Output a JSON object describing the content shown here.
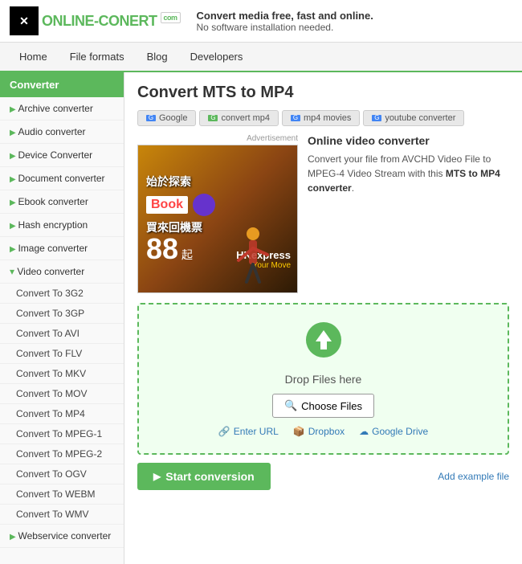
{
  "header": {
    "logo_text": "ONLINE-CON",
    "logo_text2": "ERT",
    "logo_badge": "com",
    "tagline_strong": "Convert media free, fast and online.",
    "tagline_sub": "No software installation needed."
  },
  "nav": {
    "items": [
      {
        "label": "Home"
      },
      {
        "label": "File formats"
      },
      {
        "label": "Blog"
      },
      {
        "label": "Developers"
      }
    ]
  },
  "sidebar": {
    "title": "Converter",
    "items": [
      {
        "label": "Archive converter",
        "type": "arrow"
      },
      {
        "label": "Audio converter",
        "type": "arrow"
      },
      {
        "label": "Device Converter",
        "type": "arrow"
      },
      {
        "label": "Document converter",
        "type": "arrow"
      },
      {
        "label": "Ebook converter",
        "type": "arrow"
      },
      {
        "label": "Hash encryption",
        "type": "arrow"
      },
      {
        "label": "Image converter",
        "type": "arrow"
      },
      {
        "label": "Video converter",
        "type": "open"
      },
      {
        "label": "Convert To 3G2",
        "type": "sub"
      },
      {
        "label": "Convert To 3GP",
        "type": "sub"
      },
      {
        "label": "Convert To AVI",
        "type": "sub"
      },
      {
        "label": "Convert To FLV",
        "type": "sub"
      },
      {
        "label": "Convert To MKV",
        "type": "sub"
      },
      {
        "label": "Convert To MOV",
        "type": "sub"
      },
      {
        "label": "Convert To MP4",
        "type": "sub"
      },
      {
        "label": "Convert To MPEG-1",
        "type": "sub"
      },
      {
        "label": "Convert To MPEG-2",
        "type": "sub"
      },
      {
        "label": "Convert To OGV",
        "type": "sub"
      },
      {
        "label": "Convert To WEBM",
        "type": "sub"
      },
      {
        "label": "Convert To WMV",
        "type": "sub"
      },
      {
        "label": "Webservice converter",
        "type": "arrow"
      }
    ]
  },
  "main": {
    "page_title": "Convert MTS to MP4",
    "tabs": [
      {
        "label": "Google",
        "icon": "g"
      },
      {
        "label": "convert mp4",
        "icon": "g"
      },
      {
        "label": "mp4 movies",
        "icon": "g"
      },
      {
        "label": "youtube converter",
        "icon": "g"
      }
    ],
    "ad_label": "Advertisement",
    "ad_chinese1": "始於探索",
    "ad_book": "Book",
    "ad_chinese2": "買來回機票",
    "ad_number": "88",
    "ad_unit": "起",
    "ad_brand": "HKexpress",
    "ad_slogan": "Your Move",
    "desc_title": "Online video converter",
    "desc_text": "Convert your file from AVCHD Video File to MPEG-4 Video Stream with this ",
    "desc_link": "MTS to MP4 converter",
    "desc_end": ".",
    "upload": {
      "drop_text": "Drop Files here",
      "choose_btn": "Choose Files",
      "link_url": "Enter URL",
      "link_dropbox": "Dropbox",
      "link_gdrive": "Google Drive"
    },
    "start_btn": "Start conversion",
    "add_example": "Add example file"
  }
}
